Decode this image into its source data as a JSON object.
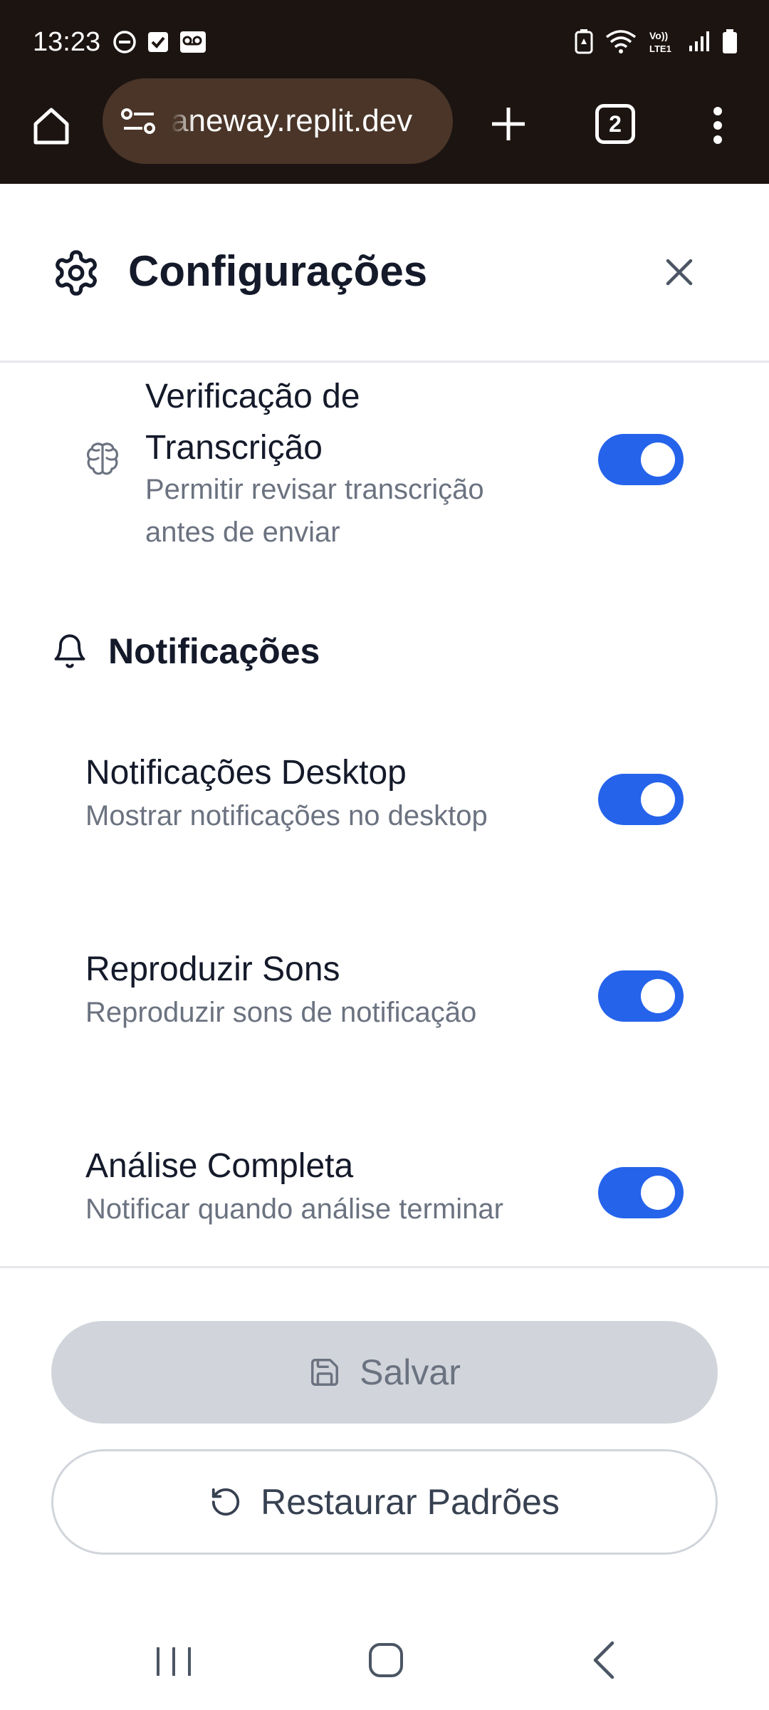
{
  "status_bar": {
    "time": "13:23",
    "left_icons": [
      "do-not-disturb-icon",
      "checkbox-notification-icon",
      "voicemail-icon"
    ],
    "right_icons": [
      "battery-saver-icon",
      "wifi-icon",
      "volte-icon",
      "signal-icon",
      "battery-icon"
    ],
    "volte_label": "Vo)) LTE1"
  },
  "browser": {
    "url": "aneway.replit.dev",
    "tab_count": "2"
  },
  "dialog": {
    "title": "Configurações"
  },
  "settings": {
    "transcription_check": {
      "title_line1": "Verificação de",
      "title_line2": "Transcrição",
      "desc_line1": "Permitir revisar transcrição",
      "desc_line2": "antes de enviar",
      "enabled": true
    },
    "notifications_section": {
      "title": "Notificações"
    },
    "desktop_notifications": {
      "title": "Notificações Desktop",
      "desc": "Mostrar notificações no desktop",
      "enabled": true
    },
    "play_sounds": {
      "title": "Reproduzir Sons",
      "desc": "Reproduzir sons de notificação",
      "enabled": true
    },
    "analysis_complete": {
      "title": "Análise Completa",
      "desc": "Notificar quando análise terminar",
      "enabled": true
    }
  },
  "actions": {
    "save_label": "Salvar",
    "restore_label": "Restaurar Padrões"
  },
  "colors": {
    "accent": "#2563eb",
    "browser_bar": "#1c1411",
    "url_pill": "#4a3528",
    "text_primary": "#141a2a",
    "text_secondary": "#6b7280",
    "save_disabled_bg": "#d1d5db"
  }
}
